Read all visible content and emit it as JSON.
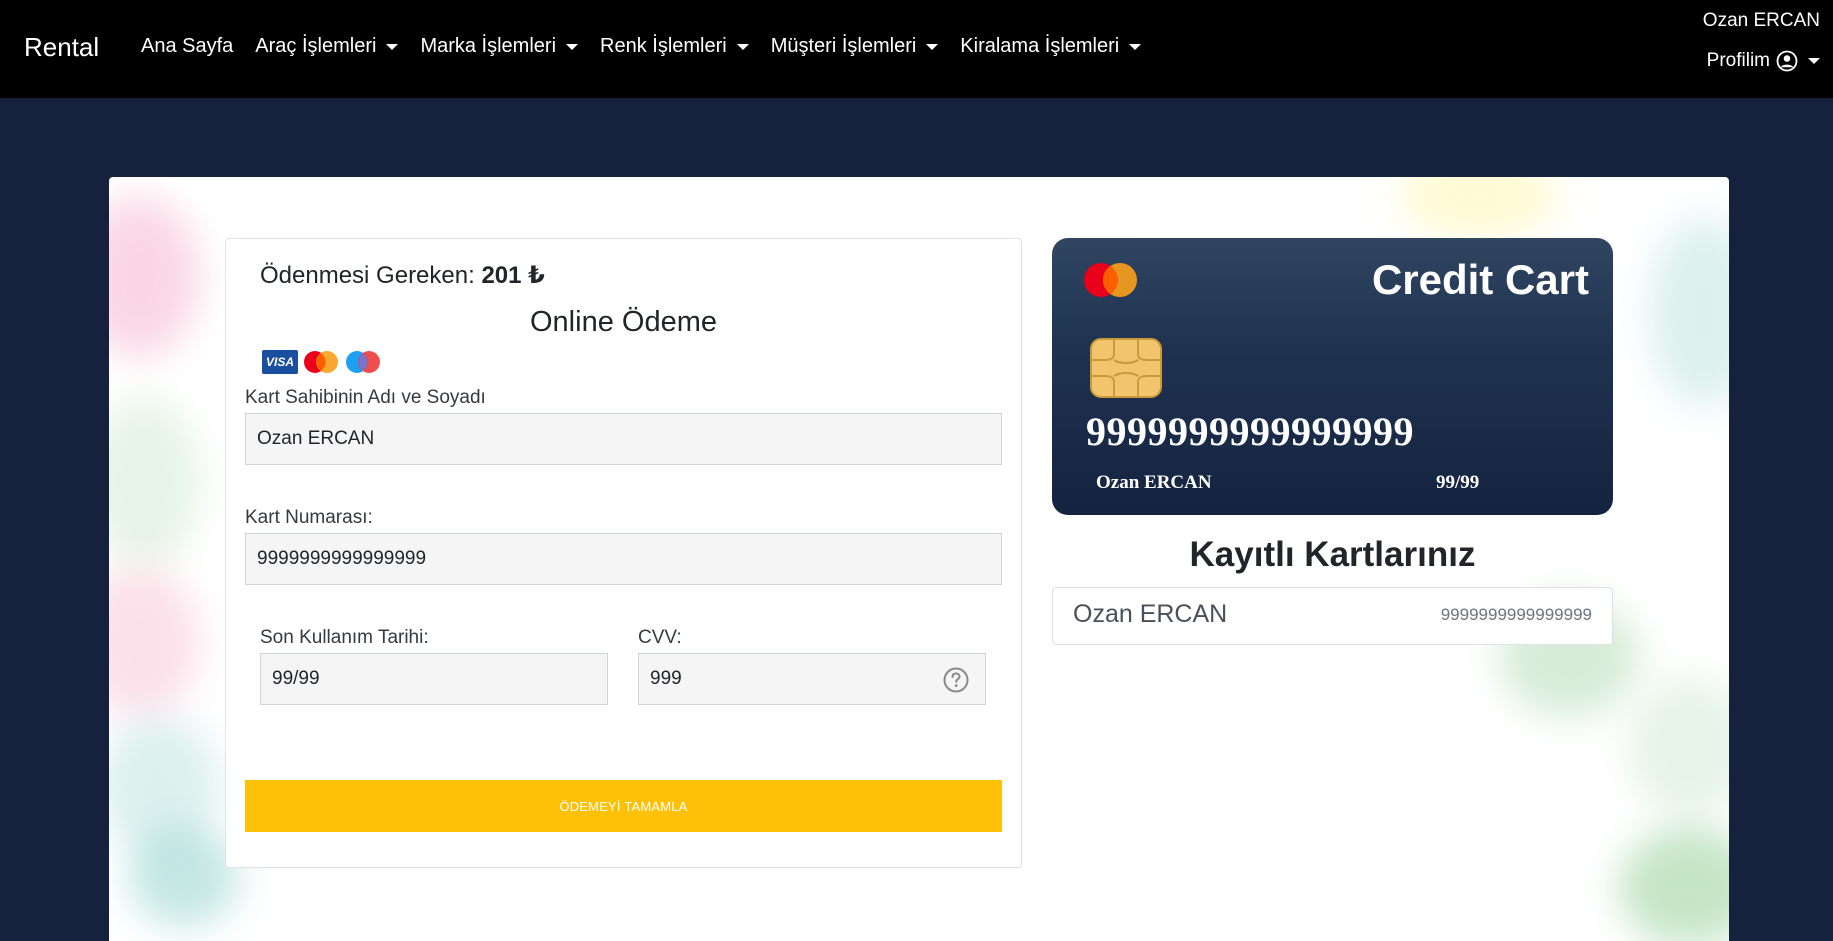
{
  "navbar": {
    "brand": "Rental",
    "items": [
      {
        "label": "Ana Sayfa",
        "dropdown": false
      },
      {
        "label": "Araç İşlemleri",
        "dropdown": true
      },
      {
        "label": "Marka İşlemleri",
        "dropdown": true
      },
      {
        "label": "Renk İşlemleri",
        "dropdown": true
      },
      {
        "label": "Müşteri İşlemleri",
        "dropdown": true
      },
      {
        "label": "Kiralama İşlemleri",
        "dropdown": true
      }
    ],
    "user_name": "Ozan ERCAN",
    "profile_label": "Profilim"
  },
  "payment": {
    "amount_label": "Ödenmesi Gereken:",
    "amount_value": "201 ₺",
    "title": "Online Ödeme",
    "card_brands": [
      "visa",
      "mastercard",
      "maestro"
    ],
    "visa_text": "VISA",
    "holder_label": "Kart Sahibinin Adı ve Soyadı",
    "holder_value": "Ozan ERCAN",
    "number_label": "Kart Numarası:",
    "number_value": "9999999999999999",
    "expiry_label": "Son Kullanım Tarihi:",
    "expiry_value": "99/99",
    "cvv_label": "CVV:",
    "cvv_value": "999",
    "submit_label": "ÖDEMEYİ TAMAMLA"
  },
  "card_preview": {
    "title": "Credit Cart",
    "number": "9999999999999999",
    "holder": "Ozan ERCAN",
    "expiry": "99/99"
  },
  "saved_cards": {
    "title": "Kayıtlı Kartlarınız",
    "items": [
      {
        "name": "Ozan ERCAN",
        "number": "9999999999999999"
      }
    ]
  },
  "colors": {
    "page_bg": "#16213e",
    "navbar_bg": "#000000",
    "button": "#ffc107",
    "card_bg": "#1f3350"
  }
}
